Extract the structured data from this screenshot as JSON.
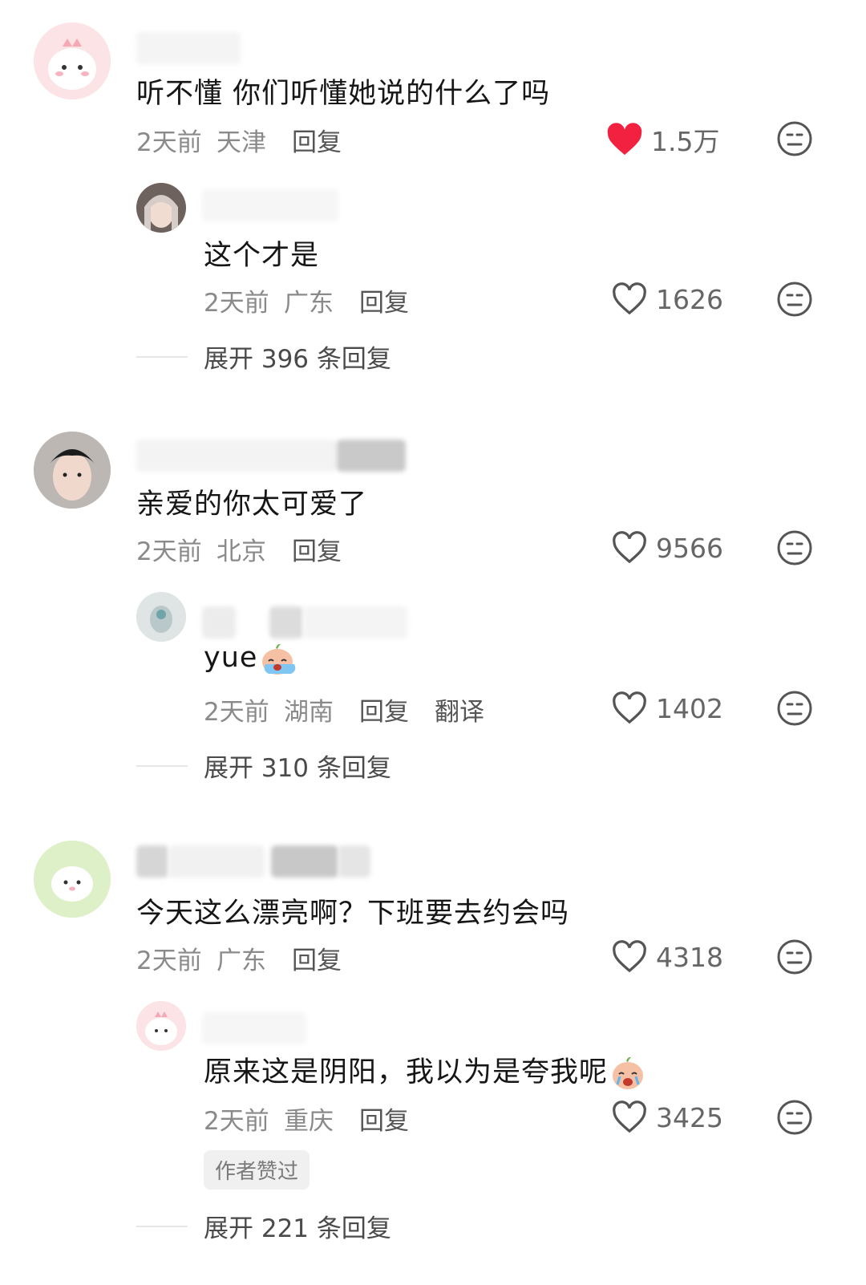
{
  "colors": {
    "heart_active": "#f2213f",
    "meta": "#8a8a8a",
    "text": "#161616"
  },
  "comments": [
    {
      "text": "听不懂 你们听懂她说的什么了吗",
      "time": "2天前",
      "location": "天津",
      "reply_label": "回复",
      "likes": "1.5万",
      "liked": true,
      "replies": [
        {
          "text": "这个才是",
          "time": "2天前",
          "location": "广东",
          "reply_label": "回复",
          "likes": "1626"
        }
      ],
      "expand_label": "展开 396 条回复"
    },
    {
      "text": "亲爱的你太可爱了",
      "time": "2天前",
      "location": "北京",
      "reply_label": "回复",
      "likes": "9566",
      "replies": [
        {
          "text": "yue",
          "emoji": "crying-face-emoji",
          "time": "2天前",
          "location": "湖南",
          "reply_label": "回复",
          "translate_label": "翻译",
          "likes": "1402"
        }
      ],
      "expand_label": "展开 310 条回复"
    },
    {
      "text": "今天这么漂亮啊？下班要去约会吗",
      "time": "2天前",
      "location": "广东",
      "reply_label": "回复",
      "likes": "4318",
      "replies": [
        {
          "text": "原来这是阴阳，我以为是夸我呢",
          "emoji": "crying-face-emoji",
          "time": "2天前",
          "location": "重庆",
          "reply_label": "回复",
          "likes": "3425",
          "badge": "作者赞过"
        }
      ],
      "expand_label": "展开 221 条回复"
    }
  ]
}
